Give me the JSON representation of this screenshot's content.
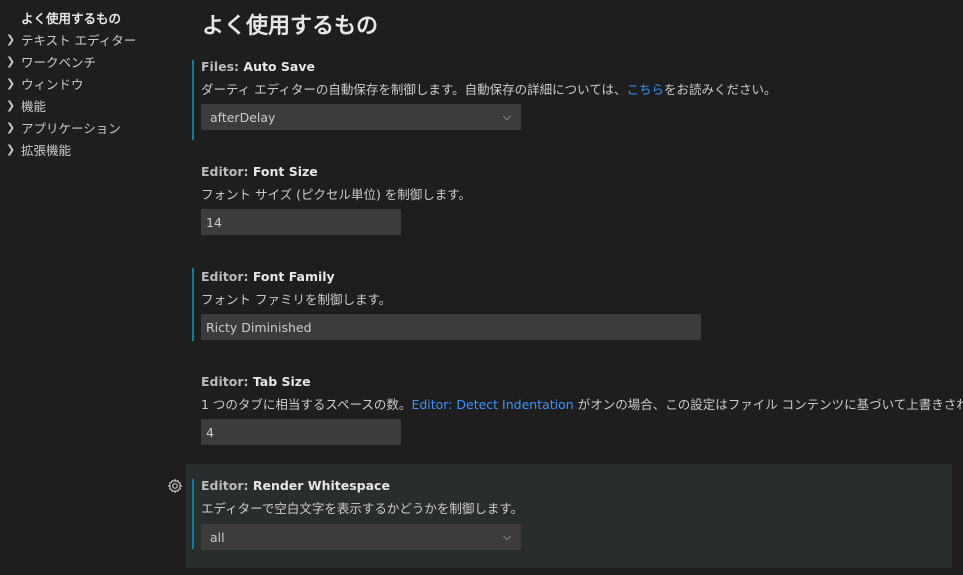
{
  "toc": {
    "items": [
      {
        "label": "よく使用するもの",
        "active": true
      },
      {
        "label": "テキスト エディター"
      },
      {
        "label": "ワークベンチ"
      },
      {
        "label": "ウィンドウ"
      },
      {
        "label": "機能"
      },
      {
        "label": "アプリケーション"
      },
      {
        "label": "拡張機能"
      }
    ]
  },
  "page": {
    "title": "よく使用するもの"
  },
  "settings": [
    {
      "category": "Files: ",
      "name": "Auto Save",
      "desc_before": "ダーティ エディターの自動保存を制御します。自動保存の詳細については、",
      "desc_link": "こちら",
      "desc_after": "をお読みください。",
      "value": "afterDelay"
    },
    {
      "category": "Editor: ",
      "name": "Font Size",
      "desc": "フォント サイズ (ピクセル単位) を制御します。",
      "value": "14"
    },
    {
      "category": "Editor: ",
      "name": "Font Family",
      "desc": "フォント ファミリを制御します。",
      "value": "Ricty Diminished"
    },
    {
      "category": "Editor: ",
      "name": "Tab Size",
      "desc_before": "1 つのタブに相当するスペースの数。",
      "desc_link": "Editor: Detect Indentation",
      "desc_after": " がオンの場合、この設定はファイル コンテンツに基づいて上書きされます。",
      "value": "4"
    },
    {
      "category": "Editor: ",
      "name": "Render Whitespace",
      "desc": "エディターで空白文字を表示するかどうかを制御します。",
      "value": "all"
    }
  ],
  "icons": {
    "chevron": "chevron-right-icon",
    "dropdown": "chevron-down-icon",
    "gear": "gear-icon"
  },
  "colors": {
    "background": "#1e1e1e",
    "modified_bar": "#0c7d9d",
    "link": "#3794ff",
    "input_bg": "#3c3c3c",
    "hover_bg": "#2a2d2e"
  }
}
